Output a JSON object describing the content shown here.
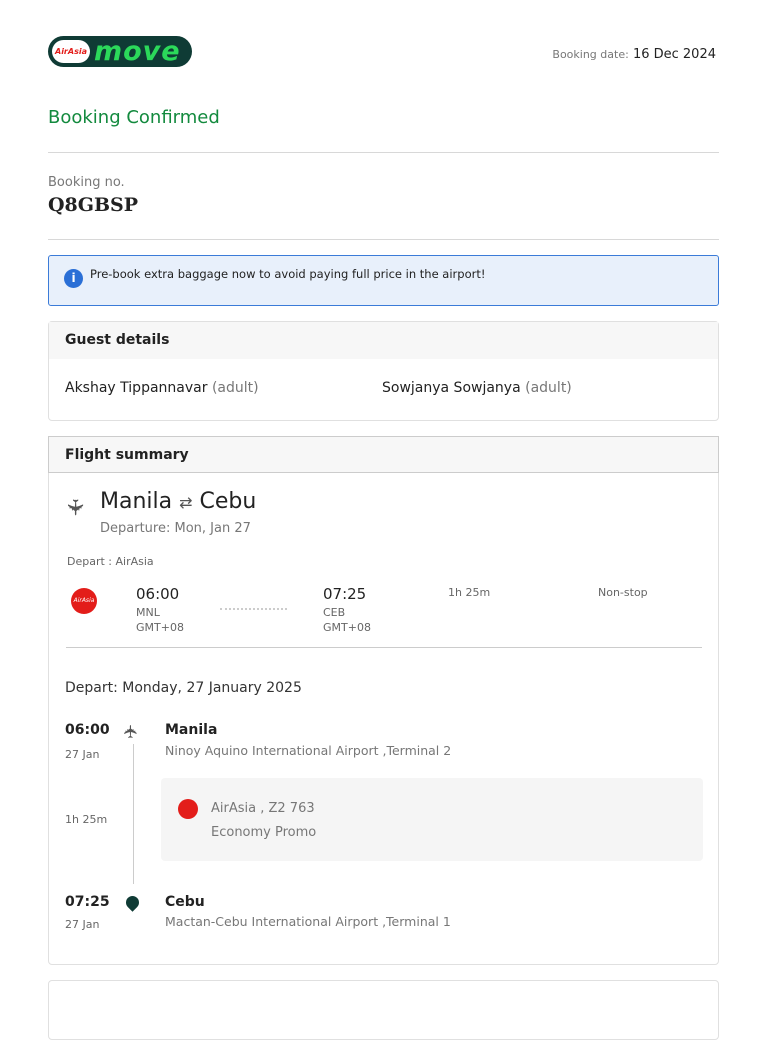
{
  "header": {
    "logo_badge": "AirAsia",
    "logo_text": "move",
    "booking_date_label": "Booking date:",
    "booking_date": "16 Dec 2024"
  },
  "status": "Booking Confirmed",
  "booking": {
    "label": "Booking no.",
    "number": "Q8GBSP"
  },
  "notice": "Pre-book extra baggage now to avoid paying full price in the airport!",
  "guests": {
    "title": "Guest details",
    "list": [
      {
        "name": "Akshay Tippannavar",
        "type": "(adult)"
      },
      {
        "name": "Sowjanya Sowjanya",
        "type": "(adult)"
      }
    ]
  },
  "flight": {
    "title": "Flight summary",
    "from": "Manila",
    "to": "Cebu",
    "departure": "Departure: Mon, Jan 27",
    "depart_airline": "Depart : AirAsia",
    "airline_logo": "AirAsia",
    "dep_time": "06:00",
    "dep_code": "MNL",
    "dep_tz": "GMT+08",
    "arr_time": "07:25",
    "arr_code": "CEB",
    "arr_tz": "GMT+08",
    "duration": "1h 25m",
    "stops": "Non-stop",
    "depart_date": "Depart: Monday, 27 January 2025",
    "seg": {
      "dep_time": "06:00",
      "dep_date": "27 Jan",
      "dep_city": "Manila",
      "dep_airport": "Ninoy Aquino International Airport ,Terminal 2",
      "duration": "1h 25m",
      "carrier": "AirAsia , Z2 763",
      "fare": "Economy Promo",
      "arr_time": "07:25",
      "arr_date": "27 Jan",
      "arr_city": "Cebu",
      "arr_airport": "Mactan-Cebu International Airport ,Terminal 1"
    }
  }
}
